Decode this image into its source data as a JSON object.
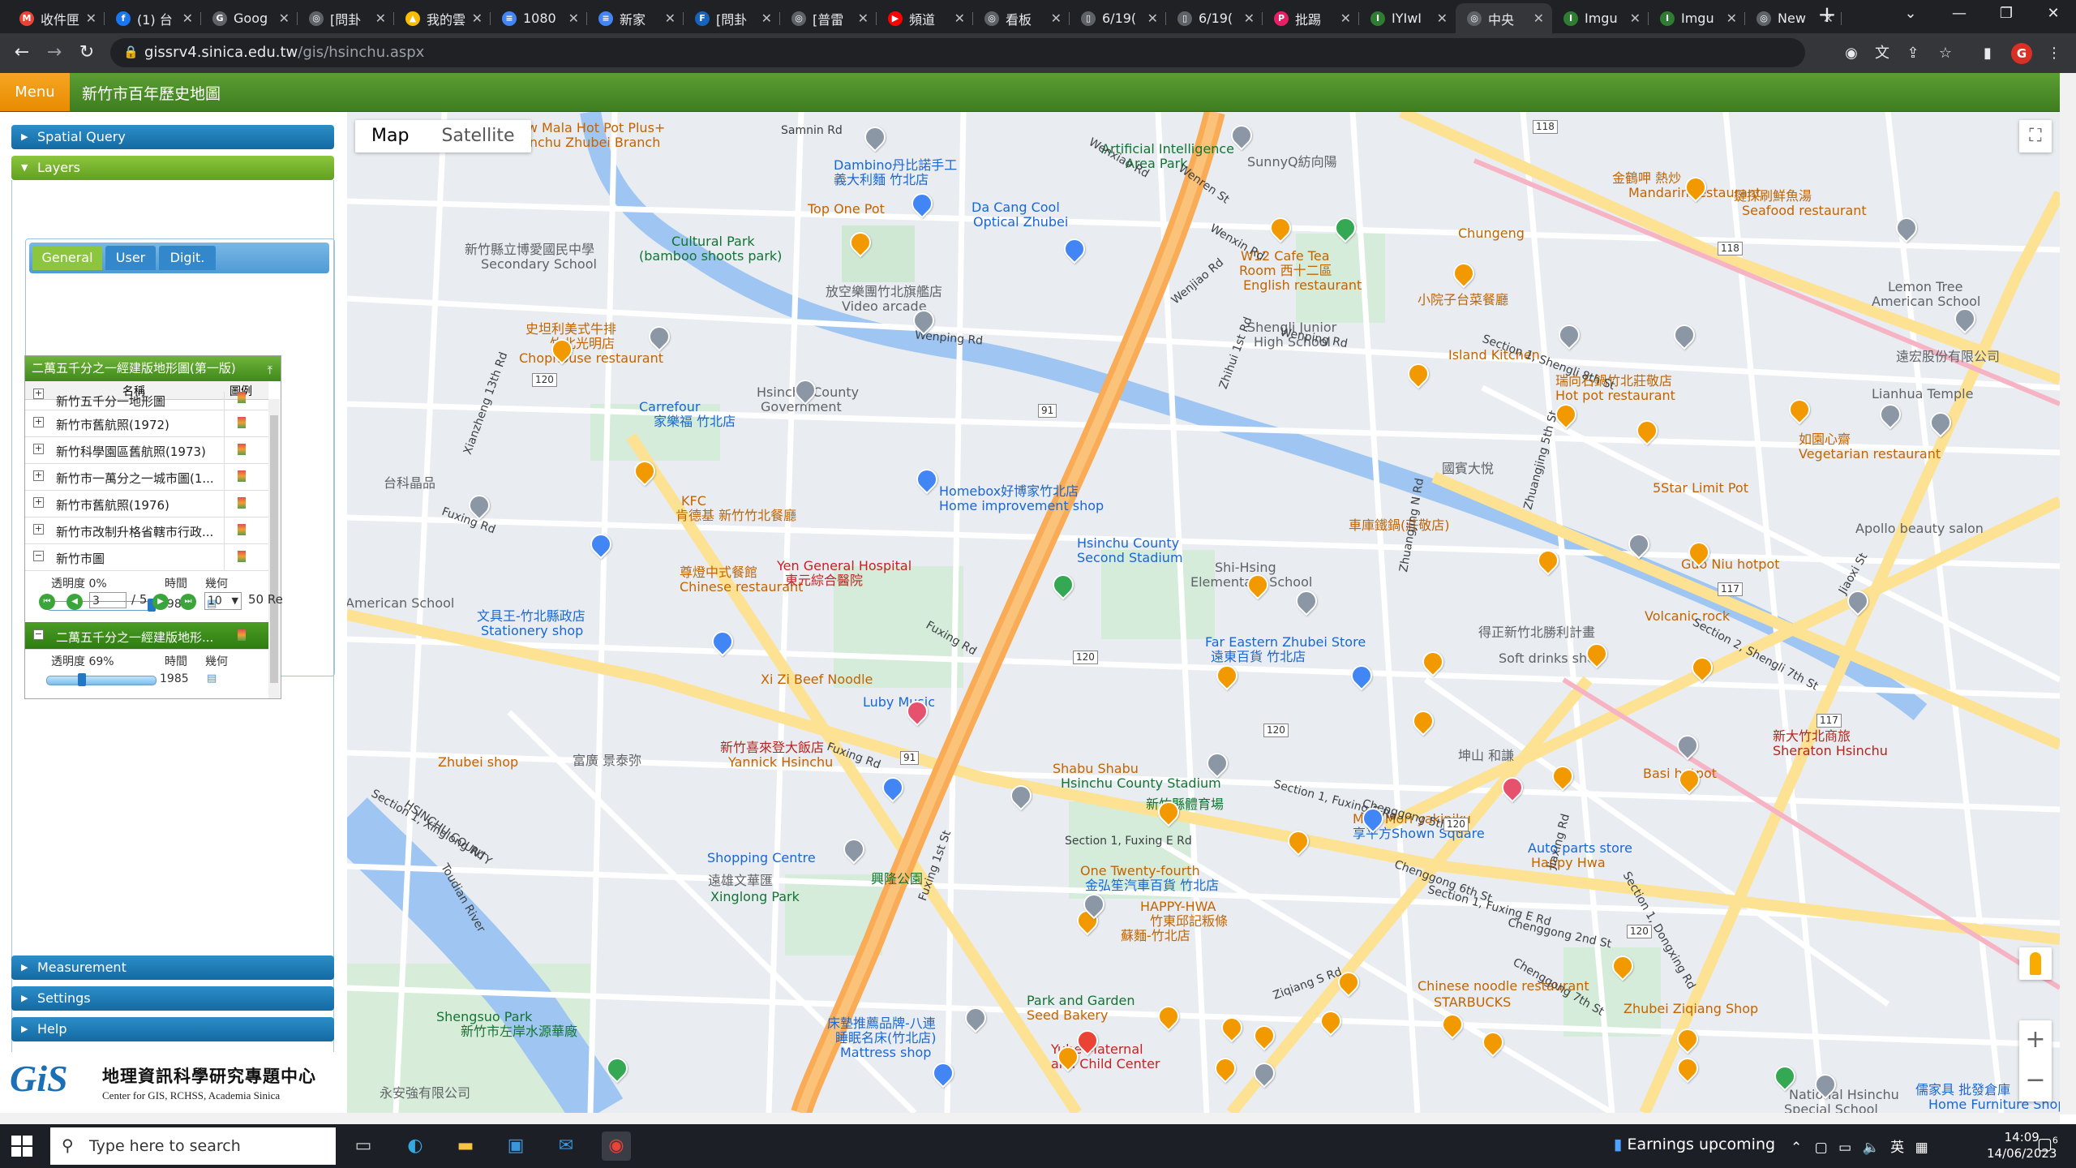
{
  "browser": {
    "tabs": [
      {
        "title": "收件匣",
        "fav": "M",
        "color": "#ea4335"
      },
      {
        "title": "(1) 台",
        "fav": "f",
        "color": "#1877f2"
      },
      {
        "title": "Goog",
        "fav": "G",
        "color": "#5f6368"
      },
      {
        "title": "[問卦",
        "fav": "◎",
        "color": "#5f6368"
      },
      {
        "title": "我的雲",
        "fav": "▲",
        "color": "#fbbc04"
      },
      {
        "title": "1080",
        "fav": "≡",
        "color": "#4285f4"
      },
      {
        "title": "新家",
        "fav": "≡",
        "color": "#4285f4"
      },
      {
        "title": "[問卦",
        "fav": "F",
        "color": "#1565c0"
      },
      {
        "title": "[普雷",
        "fav": "◎",
        "color": "#5f6368"
      },
      {
        "title": "頻道",
        "fav": "▶",
        "color": "#ff0000"
      },
      {
        "title": "看板",
        "fav": "◎",
        "color": "#5f6368"
      },
      {
        "title": "6/19(",
        "fav": "▯",
        "color": "#5f6368"
      },
      {
        "title": "6/19(",
        "fav": "▯",
        "color": "#5f6368"
      },
      {
        "title": "批踢",
        "fav": "P",
        "color": "#e91e63"
      },
      {
        "title": "IYIwI",
        "fav": "I",
        "color": "#2e7d32"
      },
      {
        "title": "中央",
        "fav": "◎",
        "color": "#5f6368"
      },
      {
        "title": "Imgu",
        "fav": "I",
        "color": "#2e7d32"
      },
      {
        "title": "Imgu",
        "fav": "I",
        "color": "#2e7d32"
      },
      {
        "title": "New",
        "fav": "◎",
        "color": "#5f6368"
      }
    ],
    "active_tab_index": 15,
    "url_host": "gissrv4.sinica.edu.tw",
    "url_path": "/gis/hsinchu.aspx",
    "profile_initial": "G"
  },
  "app": {
    "menu_label": "Menu",
    "title": "新竹市百年歷史地圖"
  },
  "sidebar": {
    "spatial_query": "Spatial Query",
    "layers": "Layers",
    "measurement": "Measurement",
    "settings": "Settings",
    "help": "Help",
    "subtabs": [
      "General",
      "User",
      "Digit."
    ],
    "grid": {
      "header": "二萬五千分之一經建版地形圖(第一版)",
      "col_name": "名稱",
      "col_legend": "圖例",
      "rows": [
        "新竹五千分一地形圖",
        "新竹市舊航照(1972)",
        "新竹科學園區舊航照(1973)",
        "新竹市一萬分之一城市圖(1...",
        "新竹市舊航照(1976)",
        "新竹市改制升格省轄市行政...",
        "新竹市圖",
        "二萬五千分之一經建版地形..."
      ],
      "sub1": {
        "opacity": "透明度 0%",
        "time_label": "時間",
        "legend_label": "幾何",
        "year": "1983",
        "opacity_value": 0
      },
      "sub2": {
        "opacity": "透明度 69%",
        "time_label": "時間",
        "legend_label": "幾何",
        "year": "1985",
        "opacity_value": 69
      }
    },
    "pager": {
      "page": "3",
      "total": "/ 5",
      "page_size": "10",
      "records": "50 Re"
    }
  },
  "logo": {
    "mark": "GiS",
    "cn": "地理資訊科學研究專題中心",
    "en": "Center for GIS, RCHSS, Academia Sinica"
  },
  "map": {
    "type_map": "Map",
    "type_satellite": "Satellite",
    "labels": [
      {
        "t": "New Mala Hot Pot Plus+",
        "c": "orange"
      },
      {
        "t": "Hsinchu Zhubei Branch",
        "c": "orange"
      },
      {
        "t": "Dambino丹比諾手工",
        "c": "blue"
      },
      {
        "t": "義大利麵 竹北店",
        "c": "blue"
      },
      {
        "t": "Artificial Intelligence",
        "c": "green"
      },
      {
        "t": "Area Park",
        "c": "green"
      },
      {
        "t": "SunnyQ紡向陽",
        "c": "grey"
      },
      {
        "t": "金鶴呷 熱炒",
        "c": "orange"
      },
      {
        "t": "Mandarin restaurant",
        "c": "orange"
      },
      {
        "t": "鍵探刷鮮魚湯",
        "c": "orange"
      },
      {
        "t": "Seafood restaurant",
        "c": "orange"
      },
      {
        "t": "Top One Pot",
        "c": "orange"
      },
      {
        "t": "Da Cang Cool",
        "c": "blue"
      },
      {
        "t": "Optical Zhubei",
        "c": "blue"
      },
      {
        "t": "Cultural Park",
        "c": "green"
      },
      {
        "t": "(bamboo shoots park)",
        "c": "green"
      },
      {
        "t": "新竹縣立博愛國民中學",
        "c": "grey"
      },
      {
        "t": "Secondary School",
        "c": "grey"
      },
      {
        "t": "W12 Cafe Tea",
        "c": "orange"
      },
      {
        "t": "Room 西十二區",
        "c": "orange"
      },
      {
        "t": "English restaurant",
        "c": "orange"
      },
      {
        "t": "Chungeng",
        "c": "orange"
      },
      {
        "t": "Lemon Tree",
        "c": "grey"
      },
      {
        "t": "American School",
        "c": "grey"
      },
      {
        "t": "放空樂團竹北旗艦店",
        "c": "grey"
      },
      {
        "t": "Video arcade",
        "c": "grey"
      },
      {
        "t": "小院子台菜餐廳",
        "c": "orange"
      },
      {
        "t": "Shengli Junior",
        "c": "grey"
      },
      {
        "t": "High School",
        "c": "grey"
      },
      {
        "t": "遠宏股份有限公司",
        "c": "grey"
      },
      {
        "t": "史坦利美式牛排",
        "c": "orange"
      },
      {
        "t": "竹北光明店",
        "c": "orange"
      },
      {
        "t": "Chophouse restaurant",
        "c": "orange"
      },
      {
        "t": "Island Kitchen",
        "c": "orange"
      },
      {
        "t": "瑞向石鍋竹北莊敬店",
        "c": "orange"
      },
      {
        "t": "Hot pot restaurant",
        "c": "orange"
      },
      {
        "t": "Lianhua Temple",
        "c": "grey"
      },
      {
        "t": "Hsinchu County",
        "c": "grey"
      },
      {
        "t": "Government",
        "c": "grey"
      },
      {
        "t": "Carrefour",
        "c": "blue"
      },
      {
        "t": "家樂福 竹北店",
        "c": "blue"
      },
      {
        "t": "如園心齋",
        "c": "orange"
      },
      {
        "t": "Vegetarian restaurant",
        "c": "orange"
      },
      {
        "t": "台科晶品",
        "c": "grey"
      },
      {
        "t": "KFC",
        "c": "orange"
      },
      {
        "t": "肯德基 新竹竹北餐廳",
        "c": "orange"
      },
      {
        "t": "Homebox好博家竹北店",
        "c": "blue"
      },
      {
        "t": "Home improvement shop",
        "c": "blue"
      },
      {
        "t": "國賓大悅",
        "c": "grey"
      },
      {
        "t": "5Star Limit Pot",
        "c": "orange"
      },
      {
        "t": "車庫鐵鍋(莊敬店)",
        "c": "orange"
      },
      {
        "t": "Apollo beauty salon",
        "c": "grey"
      },
      {
        "t": "Hsinchu County",
        "c": "blue"
      },
      {
        "t": "Second Stadium",
        "c": "blue"
      },
      {
        "t": "尊燈中式餐館",
        "c": "orange"
      },
      {
        "t": "Chinese restaurant",
        "c": "orange"
      },
      {
        "t": "Yen General Hospital",
        "c": "red"
      },
      {
        "t": "東元綜合醫院",
        "c": "red"
      },
      {
        "t": "Shi-Hsing",
        "c": "grey"
      },
      {
        "t": "Elementary School",
        "c": "grey"
      },
      {
        "t": "Guo Niu hotpot",
        "c": "orange"
      },
      {
        "t": "Volcanic rock",
        "c": "orange"
      },
      {
        "t": "American School",
        "c": "grey"
      },
      {
        "t": "文具王-竹北縣政店",
        "c": "blue"
      },
      {
        "t": "Stationery shop",
        "c": "blue"
      },
      {
        "t": "Far Eastern Zhubei Store",
        "c": "blue"
      },
      {
        "t": "遠東百貨 竹北店",
        "c": "blue"
      },
      {
        "t": "得正新竹北勝利計畫",
        "c": "grey"
      },
      {
        "t": "Soft drinks shop",
        "c": "grey"
      },
      {
        "t": "Xi Zi Beef Noodle",
        "c": "orange"
      },
      {
        "t": "Luby Music",
        "c": "blue"
      },
      {
        "t": "新大竹北商旅",
        "c": "pink"
      },
      {
        "t": "Sheraton Hsinchu",
        "c": "pink"
      },
      {
        "t": "新竹喜來登大飯店",
        "c": "pink"
      },
      {
        "t": "Yannick Hsinchu",
        "c": "orange"
      },
      {
        "t": "Zhubei shop",
        "c": "orange"
      },
      {
        "t": "富廣 景泰弥",
        "c": "grey"
      },
      {
        "t": "坤山 和謙",
        "c": "grey"
      },
      {
        "t": "Basi hotpot",
        "c": "orange"
      },
      {
        "t": "Shabu Shabu",
        "c": "orange"
      },
      {
        "t": "Hsinchu County Stadium",
        "c": "green"
      },
      {
        "t": "新竹縣體育場",
        "c": "green"
      },
      {
        "t": "Mori Mori yakiniku",
        "c": "orange"
      },
      {
        "t": "享平方Shown Square",
        "c": "blue"
      },
      {
        "t": "Shopping Centre",
        "c": "blue"
      },
      {
        "t": "遠雄文華匯",
        "c": "grey"
      },
      {
        "t": "Xinglong Park",
        "c": "green"
      },
      {
        "t": "興隆公園",
        "c": "green"
      },
      {
        "t": "One Twenty-fourth",
        "c": "orange"
      },
      {
        "t": "金弘笙汽車百貨 竹北店",
        "c": "blue"
      },
      {
        "t": "Auto parts store",
        "c": "blue"
      },
      {
        "t": "Happy Hwa",
        "c": "orange"
      },
      {
        "t": "HAPPY-HWA",
        "c": "orange"
      },
      {
        "t": "竹東邱記粄條",
        "c": "orange"
      },
      {
        "t": "蘇麵-竹北店",
        "c": "orange"
      },
      {
        "t": "Chinese noodle restaurant",
        "c": "orange"
      },
      {
        "t": "STARBUCKS",
        "c": "orange"
      },
      {
        "t": "Zhubei Ziqiang Shop",
        "c": "orange"
      },
      {
        "t": "Shengsuo Park",
        "c": "green"
      },
      {
        "t": "新竹市左岸水源華廠",
        "c": "green"
      },
      {
        "t": "Park and Garden",
        "c": "green"
      },
      {
        "t": "Seed Bakery",
        "c": "orange"
      },
      {
        "t": "床墊推薦品牌-八連",
        "c": "blue"
      },
      {
        "t": "睡眠名床(竹北店)",
        "c": "blue"
      },
      {
        "t": "Mattress shop",
        "c": "blue"
      },
      {
        "t": "Yuhe Maternal",
        "c": "red"
      },
      {
        "t": "and Child Center",
        "c": "red"
      },
      {
        "t": "永安強有限公司",
        "c": "grey"
      },
      {
        "t": "National Hsinchu",
        "c": "grey"
      },
      {
        "t": "Special School",
        "c": "grey"
      },
      {
        "t": "儒家具 批發倉庫",
        "c": "blue"
      },
      {
        "t": "Home Furniture Shop",
        "c": "blue"
      }
    ],
    "roads": [
      "Samnin Rd",
      "Wenxiao Rd",
      "Wenren St",
      "Wenxin Rd",
      "Wenjiao Rd",
      "Section 1, Shengli 8th St",
      "Wenping Rd",
      "Wenping Rd",
      "Fuxing Rd",
      "Fuxing Rd",
      "Fuxing Rd",
      "Section 1, Fuxing E Rd",
      "Section 1, Fuxing E Rd",
      "Section 1, Fuxing E Rd",
      "Section 1, Xinglong Rd",
      "Toudian River",
      "HSINCHU COUNTY",
      "Zhuangjing N Rd",
      "Zhuangjing 5th St",
      "Jiaxing Rd",
      "Section 1, Dongxing Rd",
      "Section 2, Shengli 7th St",
      "Chenggong 5th St",
      "Chenggong 6th St",
      "Chenggong 7th St",
      "Chenggong 2nd St",
      "Jiaoxi St",
      "Fuxing 1st St",
      "Ziqiang S Rd",
      "Zhihui 1st Rd",
      "Xianzheng 13th Rd"
    ],
    "shields": [
      "118",
      "118",
      "120",
      "120",
      "117",
      "91",
      "120",
      "91",
      "117",
      "120",
      "120"
    ]
  },
  "taskbar": {
    "search_placeholder": "Type here to search",
    "weather": "Earnings upcoming",
    "ime": "英",
    "time": "14:09",
    "date": "14/06/2023",
    "notif_count": "6"
  }
}
